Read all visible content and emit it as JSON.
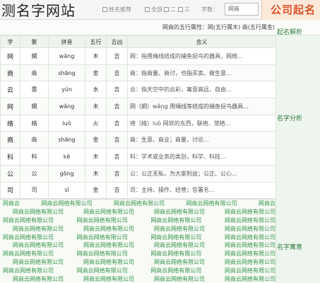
{
  "page": {
    "title": "测名字网站"
  },
  "topbar": {
    "tabs": [
      "姓名推荐",
      "全部",
      "二",
      "三"
    ],
    "input_label": "字数：",
    "input_value": "网商",
    "logo": "公司起名"
  },
  "info": {
    "text": "网商的五行属性：网(五行属木) 商(五行属金)"
  },
  "sidebar": {
    "labels": [
      "起名解析",
      "名字分析",
      "名字寓意"
    ]
  },
  "table": {
    "headers": [
      "字",
      "繁",
      "拼音",
      "五行",
      "吉凶",
      "含义"
    ],
    "rows": [
      {
        "char": "网",
        "trad": "網",
        "pinyin": "wǎng",
        "wuxing": "木",
        "jixiong": "吉",
        "meaning": "网：指用绳线结成的捕鱼捉鸟的器具，网络..."
      },
      {
        "char": "商",
        "trad": "商",
        "pinyin": "shāng",
        "wuxing": "金",
        "jixiong": "吉",
        "meaning": "商：指商量、商讨，也指买卖、做生意..."
      },
      {
        "char": "云",
        "trad": "雲",
        "pinyin": "yún",
        "wuxing": "水",
        "jixiong": "吉",
        "meaning": "云：指天空中的云彩，寓意高远、自由..."
      },
      {
        "char": "网",
        "trad": "網",
        "pinyin": "wǎng",
        "wuxing": "木",
        "jixiong": "吉",
        "meaning": "网（網）wǎng 用绳线等结成的捕鱼捉鸟器具..."
      },
      {
        "char": "络",
        "trad": "絡",
        "pinyin": "luò",
        "wuxing": "火",
        "jixiong": "吉",
        "meaning": "络（絡）luò 网状的东西，联络、笼络..."
      },
      {
        "char": "商",
        "trad": "商",
        "pinyin": "shāng",
        "wuxing": "金",
        "jixiong": "吉",
        "meaning": "商：生意、商业；商量，讨论..."
      },
      {
        "char": "科",
        "trad": "科",
        "pinyin": "kē",
        "wuxing": "木",
        "jixiong": "吉",
        "meaning": "科：学术或业务的类别，科学、科技..."
      },
      {
        "char": "公",
        "trad": "公",
        "pinyin": "gōng",
        "wuxing": "木",
        "jixiong": "吉",
        "meaning": "公：公正无私，为大家利益；公正、公心..."
      },
      {
        "char": "司",
        "trad": "司",
        "pinyin": "sī",
        "wuxing": "金",
        "jixiong": "吉",
        "meaning": "司：主持、操作、经营；官署名..."
      }
    ]
  },
  "watermark": {
    "rows": [
      [
        "网商云",
        "网商云网络有限公司",
        "网商云网络有限公司",
        "网商云网络有限公司",
        "网商云"
      ],
      [
        "网商云网络有限公司",
        "网商云网络有限公司",
        "网商云网络有限公司",
        "网商云网络有限公司"
      ],
      [
        "网商云网络有限公司",
        "网商云网络有限公司",
        "网商云网络有限公司",
        "网商云网络有限公司"
      ],
      [
        "网商云网络有限公司",
        "网商云网络有限公司",
        "网商云网络有限公司",
        "网商云网络有限公司"
      ],
      [
        "网商云网络有限公司",
        "网商云网络有限公司",
        "网商云网络有限公司",
        "网商云网络有限公司"
      ],
      [
        "网商云网络有限公司",
        "网商云网络有限公司",
        "网商云网络有限公司",
        "网商云网络有限公司"
      ],
      [
        "网商云网络有限公司",
        "网商云网络有限公司",
        "网商云网络有限公司",
        "网商云网络有限公司"
      ],
      [
        "网商云网络有限公司",
        "网商云网络有限公司",
        "网商云网络有限公司",
        "网商云网络有限公司"
      ],
      [
        "网商云网络有限公司",
        "网商云网络有限公司",
        "网商云网络有限公司",
        "网商云网络有限公司"
      ],
      [
        "网商云网络有限公司",
        "网商云网络有限公司",
        "网商云网络有限公司",
        "网商云网络有限公司"
      ]
    ]
  },
  "colors": {
    "accent": "#d9532b",
    "green": "#1e8a3a",
    "header_bg": "#eff3ee"
  }
}
